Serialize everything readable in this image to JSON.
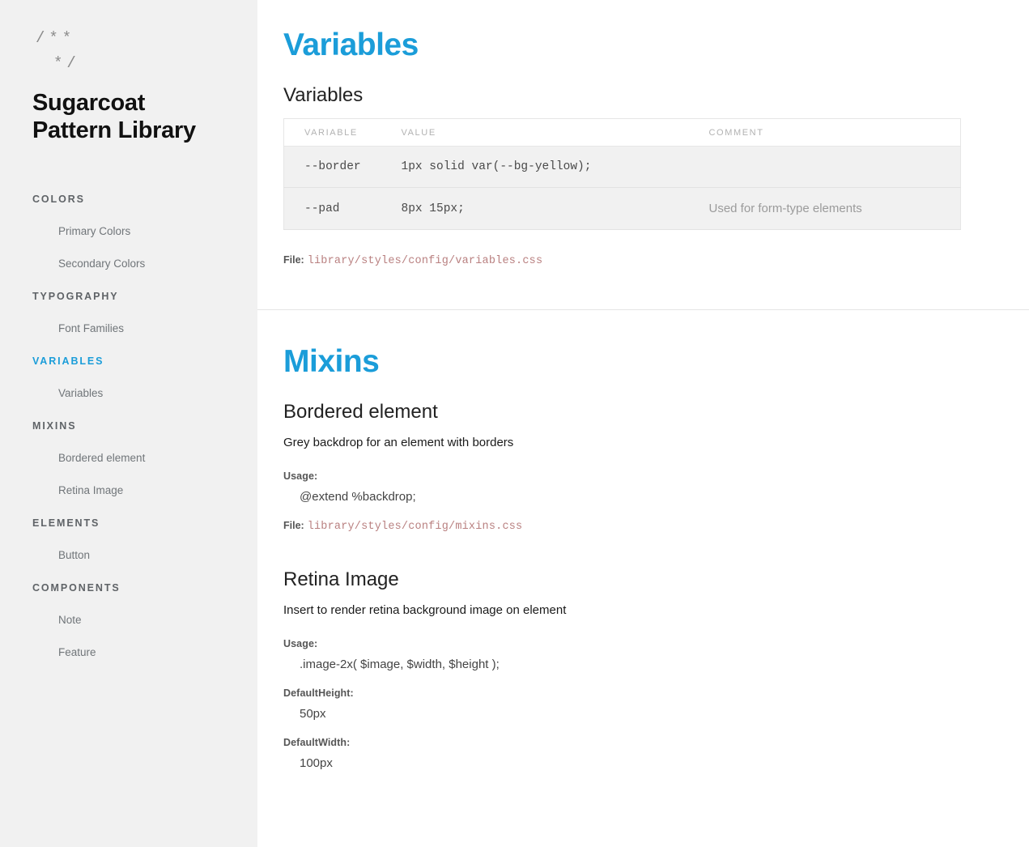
{
  "sidebar": {
    "logo": {
      "line1": "/**",
      "line2": "*/"
    },
    "title": {
      "line1": "Sugarcoat",
      "line2": "Pattern Library"
    },
    "groups": [
      {
        "section": "COLORS",
        "active": false,
        "items": [
          "Primary Colors",
          "Secondary Colors"
        ]
      },
      {
        "section": "TYPOGRAPHY",
        "active": false,
        "items": [
          "Font Families"
        ]
      },
      {
        "section": "VARIABLES",
        "active": true,
        "items": [
          "Variables"
        ]
      },
      {
        "section": "MIXINS",
        "active": false,
        "items": [
          "Bordered element",
          "Retina Image"
        ]
      },
      {
        "section": "ELEMENTS",
        "active": false,
        "items": [
          "Button"
        ]
      },
      {
        "section": "COMPONENTS",
        "active": false,
        "items": [
          "Note",
          "Feature"
        ]
      }
    ]
  },
  "variables_section": {
    "heading": "Variables",
    "block_heading": "Variables",
    "table": {
      "headers": [
        "VARIABLE",
        "VALUE",
        "COMMENT"
      ],
      "rows": [
        {
          "variable": "--border",
          "value": "1px solid var(--bg-yellow);",
          "comment": ""
        },
        {
          "variable": "--pad",
          "value": "8px 15px;",
          "comment": "Used for form-type elements"
        }
      ]
    },
    "file_label": "File:",
    "file_path": "library/styles/config/variables.css"
  },
  "mixins_section": {
    "heading": "Mixins",
    "blocks": [
      {
        "heading": "Bordered element",
        "description": "Grey backdrop for an element with borders",
        "usage_label": "Usage:",
        "usage_value": "@extend %backdrop;",
        "file_label": "File:",
        "file_path": "library/styles/config/mixins.css"
      },
      {
        "heading": "Retina Image",
        "description": "Insert to render retina background image on element",
        "usage_label": "Usage:",
        "usage_value": ".image-2x( $image, $width, $height );",
        "default_height_label": "DefaultHeight:",
        "default_height_value": "50px",
        "default_width_label": "DefaultWidth:",
        "default_width_value": "100px"
      }
    ]
  },
  "colors": {
    "accent": "#1b9dd9",
    "sidebar_bg": "#f1f1f1",
    "table_row_bg": "#f1f1f1",
    "file_path_color": "#b98080",
    "muted_text": "#9b9b9b"
  }
}
